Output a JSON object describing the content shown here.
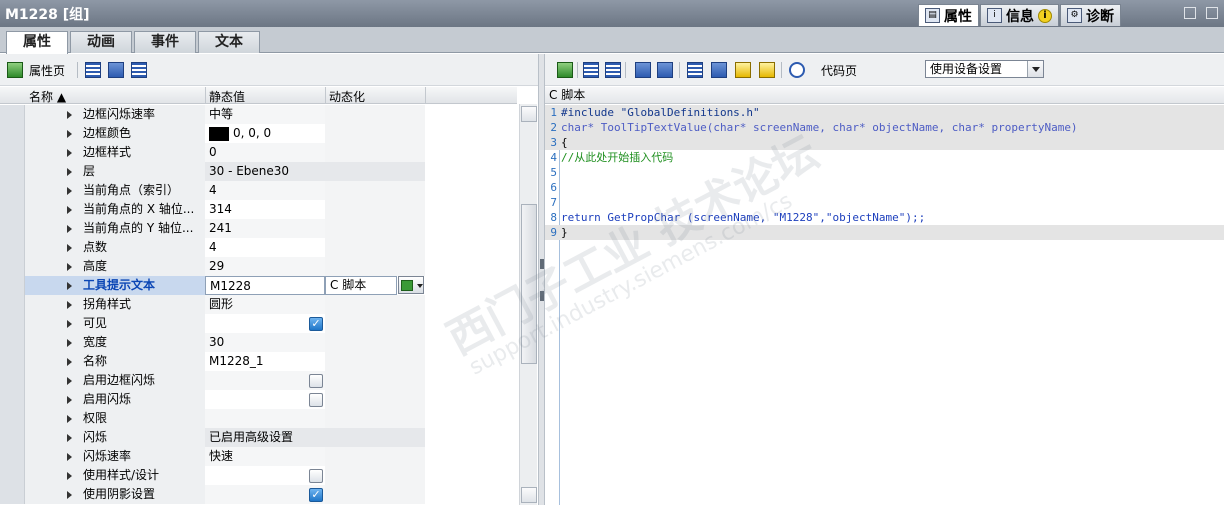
{
  "window": {
    "title": "M1228 [组]"
  },
  "inspector_tabs": [
    {
      "label": "属性",
      "icon": "properties-icon"
    },
    {
      "label": "信息",
      "icon": "info-icon"
    },
    {
      "label": "诊断",
      "icon": "diagnostics-icon"
    }
  ],
  "main_tabs": [
    "属性",
    "动画",
    "事件",
    "文本"
  ],
  "left_toolbar": {
    "property_page_label": "属性页"
  },
  "grid": {
    "headers": {
      "name": "名称",
      "static_value": "静态值",
      "dynamic": "动态化"
    },
    "rows": [
      {
        "name": "边框闪烁速率",
        "value": "中等"
      },
      {
        "name": "边框颜色",
        "value": "0, 0, 0",
        "swatch": "#000000"
      },
      {
        "name": "边框样式",
        "value": "0"
      },
      {
        "name": "层",
        "value": "30 - Ebene30"
      },
      {
        "name": "当前角点（索引）",
        "value": "4"
      },
      {
        "name": "当前角点的 X 轴位...",
        "value": "314"
      },
      {
        "name": "当前角点的 Y 轴位...",
        "value": "241"
      },
      {
        "name": "点数",
        "value": "4"
      },
      {
        "name": "高度",
        "value": "29"
      },
      {
        "name": "工具提示文本",
        "value": "M1228",
        "dynamic": "C 脚本"
      },
      {
        "name": "拐角样式",
        "value": "圆形"
      },
      {
        "name": "可见",
        "checked": true
      },
      {
        "name": "宽度",
        "value": "30"
      },
      {
        "name": "名称",
        "value": "M1228_1"
      },
      {
        "name": "启用边框闪烁",
        "checked": false
      },
      {
        "name": "启用闪烁",
        "checked": false
      },
      {
        "name": "权限",
        "value": ""
      },
      {
        "name": "闪烁",
        "value": "已启用高级设置"
      },
      {
        "name": "闪烁速率",
        "value": "快速"
      },
      {
        "name": "使用样式/设计",
        "checked": false
      },
      {
        "name": "使用阴影设置",
        "checked": true
      }
    ]
  },
  "right_toolbar": {
    "code_page_label": "代码页",
    "code_page_select": "使用设备设置"
  },
  "script": {
    "header": "C 脚本",
    "lines": [
      {
        "n": "1",
        "text": "#include \"GlobalDefinitions.h\""
      },
      {
        "n": "2",
        "text": "char* ToolTipTextValue(char* screenName, char* objectName, char* propertyName)"
      },
      {
        "n": "3",
        "text": "{"
      },
      {
        "n": "4",
        "text": "//从此处开始插入代码"
      },
      {
        "n": "5",
        "text": ""
      },
      {
        "n": "6",
        "text": ""
      },
      {
        "n": "7",
        "text": ""
      },
      {
        "n": "8",
        "text": "return GetPropChar (screenName, \"M1228\",\"objectName\");;"
      },
      {
        "n": "9",
        "text": "}"
      }
    ]
  },
  "watermark": {
    "line1": "西门子工业  技术论坛",
    "line2": "support.industry.siemens.com/cs"
  }
}
